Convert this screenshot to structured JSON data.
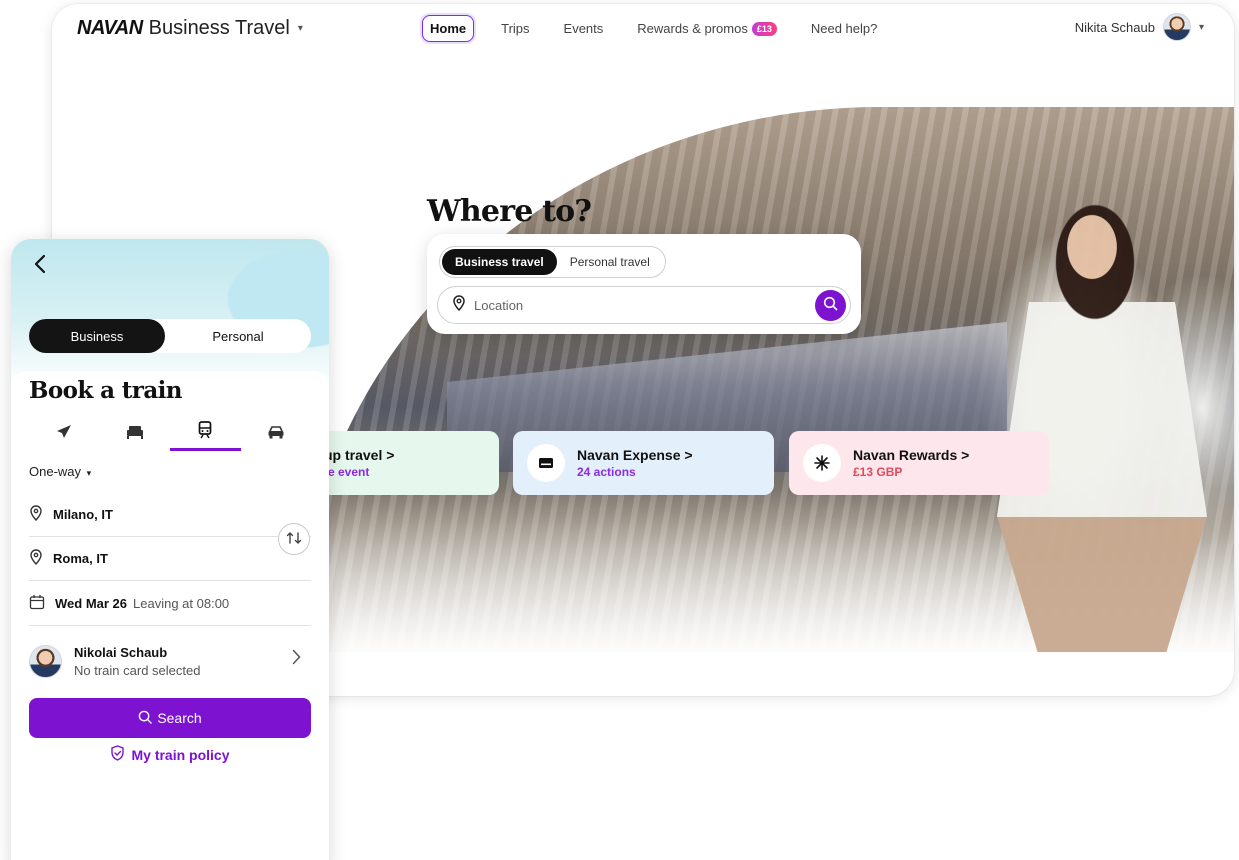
{
  "desktop": {
    "brand": {
      "logo": "NAVAN",
      "product": "Business Travel",
      "caret": "▾"
    },
    "nav": [
      {
        "label": "Home",
        "active": true
      },
      {
        "label": "Trips"
      },
      {
        "label": "Events"
      },
      {
        "label": "Rewards & promos",
        "badge": "£13"
      },
      {
        "label": "Need help?"
      }
    ],
    "user": {
      "name": "Nikita Schaub",
      "caret": "▾"
    },
    "hero_title": "Where to?",
    "search": {
      "toggle": [
        "Business travel",
        "Personal travel"
      ],
      "selected": "Business travel",
      "location_placeholder": "Location"
    },
    "tiles": [
      {
        "title": "up travel >",
        "subtitle": "te event"
      },
      {
        "title": "Navan Expense >",
        "subtitle": "24 actions",
        "icon": "card-icon"
      },
      {
        "title": "Navan Rewards >",
        "subtitle": "£13 GBP",
        "icon": "sparkle-icon"
      }
    ]
  },
  "mobile": {
    "segments": [
      "Business",
      "Personal"
    ],
    "selected_segment": "Business",
    "title": "Book a train",
    "modes": [
      "flight-icon",
      "hotel-icon",
      "train-icon",
      "car-icon"
    ],
    "selected_mode": "train-icon",
    "trip_type": "One-way",
    "trip_type_caret": "▾",
    "from": "Milano, IT",
    "to": "Roma, IT",
    "date": {
      "day": "Wed Mar 26",
      "time": "Leaving at 08:00"
    },
    "traveller": {
      "name": "Nikolai Schaub",
      "card": "No train card selected"
    },
    "search_label": "Search",
    "policy_label": "My train policy"
  },
  "colors": {
    "accent": "#7d12d1",
    "expense_tile": "#e4effc",
    "rewards_tile": "#fde7ec",
    "group_tile": "#e6f7ee"
  }
}
